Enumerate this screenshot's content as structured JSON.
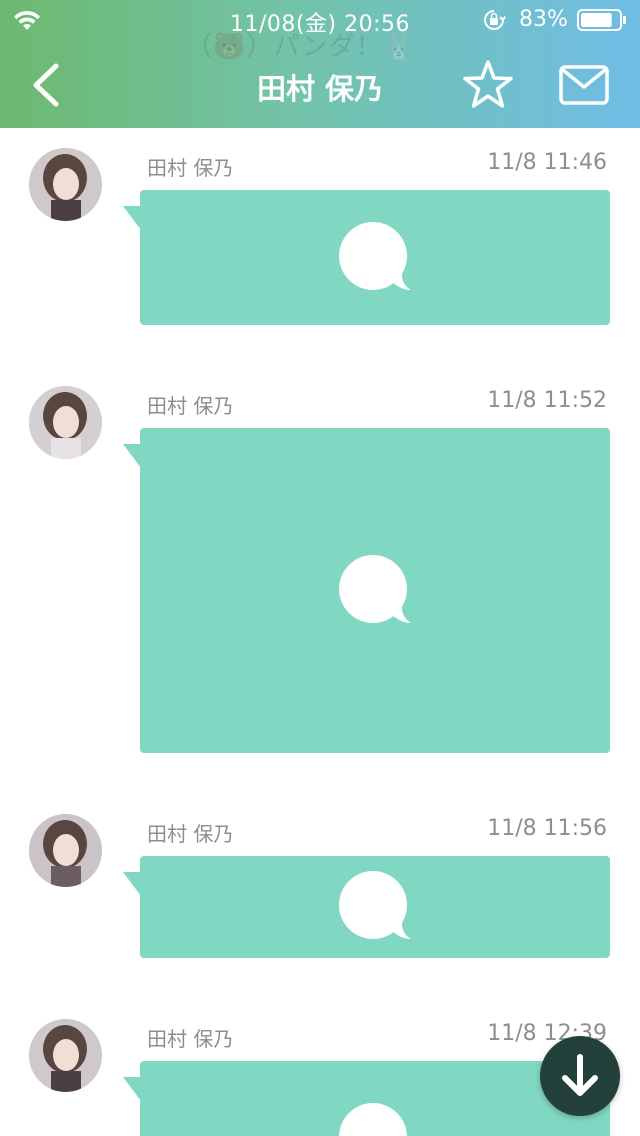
{
  "status_bar": {
    "time": "11/08(金) 20:56",
    "battery_percent": "83%",
    "battery_level": 0.83,
    "icons": [
      "wifi-icon",
      "orientation-lock-icon",
      "battery-icon"
    ]
  },
  "header": {
    "watermark": "（🐻）パンダ！🐰",
    "title": "田村 保乃",
    "icons": [
      "chevron-left-icon",
      "star-icon",
      "mail-icon"
    ]
  },
  "messages": [
    {
      "sender": "田村 保乃",
      "time": "11/8 11:46"
    },
    {
      "sender": "田村 保乃",
      "time": "11/8 11:52"
    },
    {
      "sender": "田村 保乃",
      "time": "11/8 11:56"
    },
    {
      "sender": "田村 保乃",
      "time": "11/8 12:39"
    }
  ],
  "colors": {
    "bubble": "#80d7c2",
    "header_gradient_start": "#6db86f",
    "header_gradient_end": "#6fbde6",
    "scroll_button": "#24403a"
  }
}
